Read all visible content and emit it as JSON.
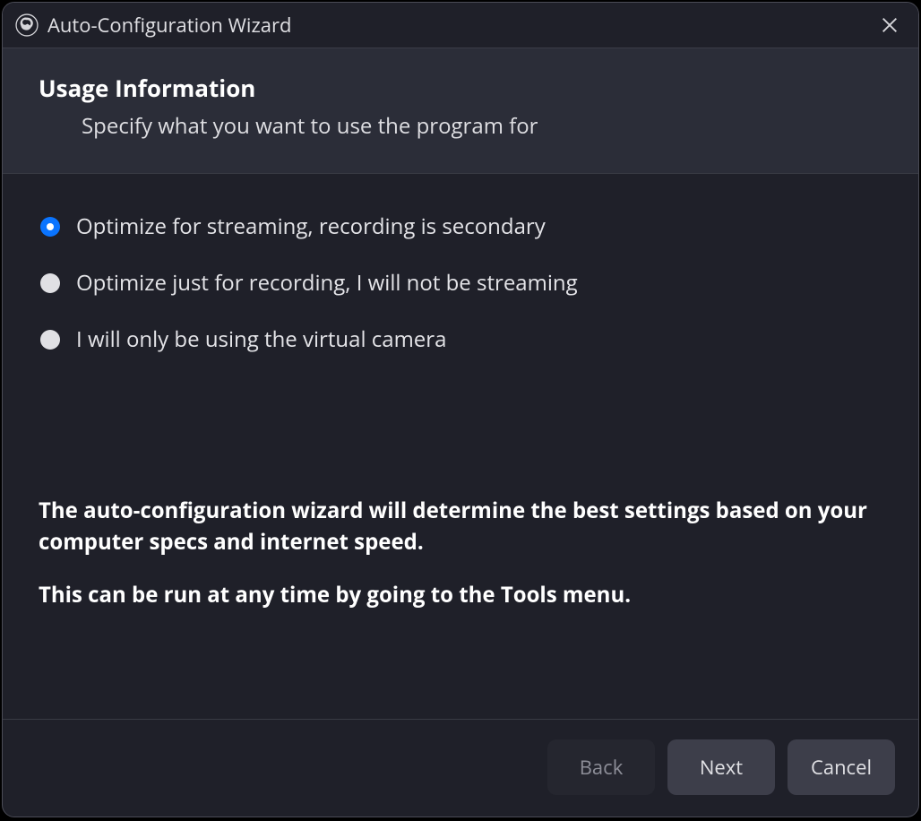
{
  "window": {
    "title": "Auto-Configuration Wizard"
  },
  "header": {
    "title": "Usage Information",
    "subtitle": "Specify what you want to use the program for"
  },
  "options": {
    "items": [
      {
        "label": "Optimize for streaming, recording is secondary",
        "selected": true
      },
      {
        "label": "Optimize just for recording, I will not be streaming",
        "selected": false
      },
      {
        "label": "I will only be using the virtual camera",
        "selected": false
      }
    ]
  },
  "info": {
    "para1": "The auto-configuration wizard will determine the best settings based on your computer specs and internet speed.",
    "para2": "This can be run at any time by going to the Tools menu."
  },
  "footer": {
    "back_label": "Back",
    "next_label": "Next",
    "cancel_label": "Cancel"
  }
}
